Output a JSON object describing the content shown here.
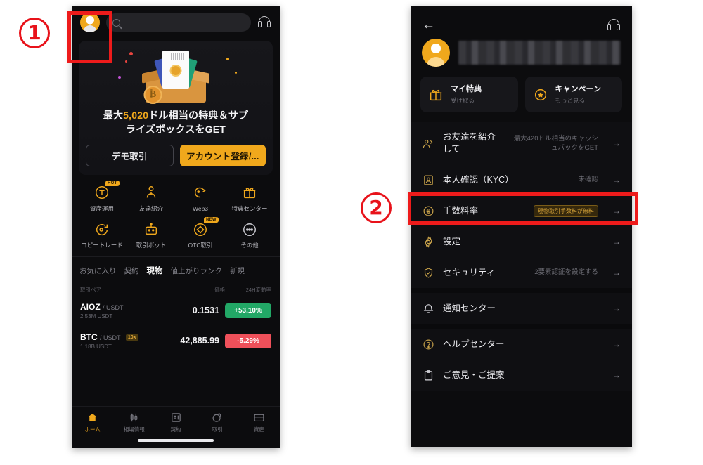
{
  "annotations": {
    "markers": [
      {
        "id": "1",
        "label": "①",
        "text": "1"
      },
      {
        "id": "2",
        "label": "②",
        "text": "2"
      }
    ],
    "highlight_color": "#ee1b1b"
  },
  "left_phone": {
    "topbar": {
      "avatar_icon": "user-avatar-icon",
      "search_placeholder": "",
      "search_icon": "search-icon",
      "support_icon": "headset-icon"
    },
    "banner": {
      "illustration": "gift-box-icon",
      "title_prefix": "最大",
      "title_amount": "5,020",
      "title_suffix": "ドル相当の特典＆サプ",
      "title_line2": "ライズボックスをGET",
      "btn_demo": "デモ取引",
      "btn_register": "アカウント登録/...",
      "accent": "#f0a81c"
    },
    "quick_actions": [
      {
        "label": "資産運用",
        "icon": "token-coin-icon",
        "badge": "HOT"
      },
      {
        "label": "友達紹介",
        "icon": "person-money-icon",
        "badge": ""
      },
      {
        "label": "Web3",
        "icon": "web3-head-icon",
        "badge": ""
      },
      {
        "label": "特典センター",
        "icon": "gift-icon",
        "badge": ""
      },
      {
        "label": "コピートレード",
        "icon": "copy-trade-icon",
        "badge": ""
      },
      {
        "label": "取引ボット",
        "icon": "robot-icon",
        "badge": ""
      },
      {
        "label": "OTC取引",
        "icon": "otc-diamond-icon",
        "badge": "NEW"
      },
      {
        "label": "その他",
        "icon": "more-dots-icon",
        "badge": ""
      }
    ],
    "market": {
      "tabs": [
        {
          "label": "お気に入り",
          "active": false
        },
        {
          "label": "契約",
          "active": false
        },
        {
          "label": "現物",
          "active": true
        },
        {
          "label": "値上がりランク",
          "active": false
        },
        {
          "label": "新規",
          "active": false
        }
      ],
      "headers": {
        "pair": "取引ペア",
        "price": "価格",
        "change": "24H変動率"
      },
      "rows": [
        {
          "base": "AIOZ",
          "quote": "/ USDT",
          "leverage": "",
          "volume": "2.53M USDT",
          "price": "0.1531",
          "change": "+53.10%",
          "direction": "up",
          "color": "#22a866"
        },
        {
          "base": "BTC",
          "quote": "/ USDT",
          "leverage": "10x",
          "volume": "1.18B USDT",
          "price": "42,885.99",
          "change": "-5.29%",
          "direction": "down",
          "color": "#ef505a"
        }
      ]
    },
    "tabbar": [
      {
        "label": "ホーム",
        "icon": "home-icon",
        "active": true
      },
      {
        "label": "相場情報",
        "icon": "candles-icon",
        "active": false
      },
      {
        "label": "契約",
        "icon": "contract-icon",
        "active": false
      },
      {
        "label": "取引",
        "icon": "trade-swap-icon",
        "active": false
      },
      {
        "label": "資産",
        "icon": "wallet-icon",
        "active": false
      }
    ]
  },
  "right_phone": {
    "topbar": {
      "back_icon": "back-arrow-icon",
      "support_icon": "headset-icon"
    },
    "profile": {
      "avatar_icon": "user-avatar-icon",
      "username_masked": ""
    },
    "promo_cards": [
      {
        "title": "マイ特典",
        "subtitle": "受け取る",
        "icon": "gift-icon"
      },
      {
        "title": "キャンペーン",
        "subtitle": "もっと見る",
        "icon": "star-badge-icon"
      }
    ],
    "menu_groups": [
      {
        "items": [
          {
            "label": "お友達を紹介して",
            "sub": "最大420ドル相当のキャッシュバックをGET",
            "badge": "",
            "icon": "referral-people-icon",
            "arrow": "→"
          },
          {
            "label": "本人確認（KYC）",
            "sub": "未確認",
            "badge": "",
            "icon": "id-card-icon",
            "arrow": "→",
            "highlighted": true
          },
          {
            "label": "手数料率",
            "sub": "",
            "badge": "現物取引手数料が無料",
            "icon": "fee-coin-icon",
            "arrow": "→"
          },
          {
            "label": "設定",
            "sub": "",
            "badge": "",
            "icon": "gear-icon",
            "arrow": "→"
          },
          {
            "label": "セキュリティ",
            "sub": "2要素認証を設定する",
            "badge": "",
            "icon": "shield-icon",
            "arrow": "→"
          }
        ]
      },
      {
        "items": [
          {
            "label": "通知センター",
            "sub": "",
            "badge": "",
            "icon": "bell-icon",
            "arrow": "→"
          }
        ]
      },
      {
        "items": [
          {
            "label": "ヘルプセンター",
            "sub": "",
            "badge": "",
            "icon": "help-circle-icon",
            "arrow": "→"
          },
          {
            "label": "ご意見・ご提案",
            "sub": "",
            "badge": "",
            "icon": "clipboard-icon",
            "arrow": "→"
          }
        ]
      }
    ]
  }
}
